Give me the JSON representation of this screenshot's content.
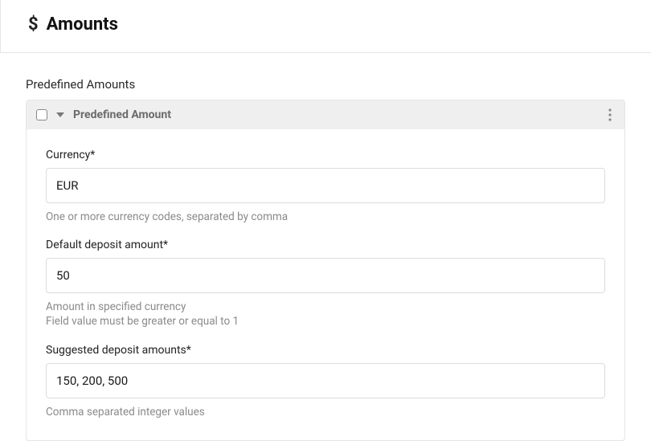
{
  "header": {
    "title": "Amounts"
  },
  "section": {
    "label": "Predefined Amounts",
    "cardTitle": "Predefined Amount"
  },
  "fields": {
    "currency": {
      "label": "Currency*",
      "value": "EUR",
      "help": "One or more currency codes, separated by comma"
    },
    "defaultAmount": {
      "label": "Default deposit amount*",
      "value": "50",
      "help1": "Amount in specified currency",
      "help2": "Field value must be greater or equal to 1"
    },
    "suggested": {
      "label": "Suggested deposit amounts*",
      "value": "150, 200, 500",
      "help": "Comma separated integer values"
    }
  }
}
